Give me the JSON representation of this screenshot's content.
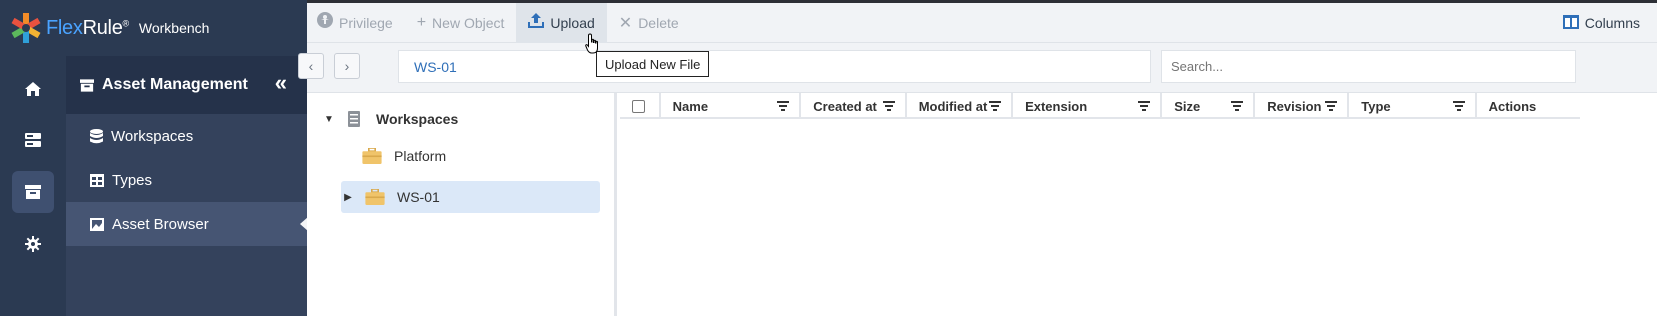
{
  "app": {
    "brand_flex": "Flex",
    "brand_rule": "Rule",
    "brand_reg": "®",
    "subtitle": "Workbench"
  },
  "rail": {
    "items": [
      {
        "icon": "home-icon"
      },
      {
        "icon": "server-icon"
      },
      {
        "icon": "archive-icon",
        "active": true
      },
      {
        "icon": "gear-icon"
      }
    ]
  },
  "sidepanel": {
    "title": "Asset Management",
    "collapse_glyph": "«",
    "items": [
      {
        "label": "Workspaces",
        "icon": "database-icon"
      },
      {
        "label": "Types",
        "icon": "table-icon"
      },
      {
        "label": "Asset Browser",
        "icon": "image-icon",
        "active": true
      }
    ]
  },
  "toolbar": {
    "privilege": "Privilege",
    "new_object": "New Object",
    "upload": "Upload",
    "delete": "Delete",
    "columns": "Columns"
  },
  "tooltip": "Upload New File",
  "navbar": {
    "path": "WS-01",
    "search_placeholder": "Search..."
  },
  "tree": {
    "root": "Workspaces",
    "children": [
      "Platform",
      "WS-01"
    ],
    "selected": "WS-01"
  },
  "grid": {
    "columns": [
      "Name",
      "Created at",
      "Modified at",
      "Extension",
      "Size",
      "Revision",
      "Type",
      "Actions"
    ],
    "rows": []
  },
  "colors": {
    "accent": "#2f6fb8",
    "sidebar": "#34425c",
    "selected_row": "#dbe8f8"
  }
}
